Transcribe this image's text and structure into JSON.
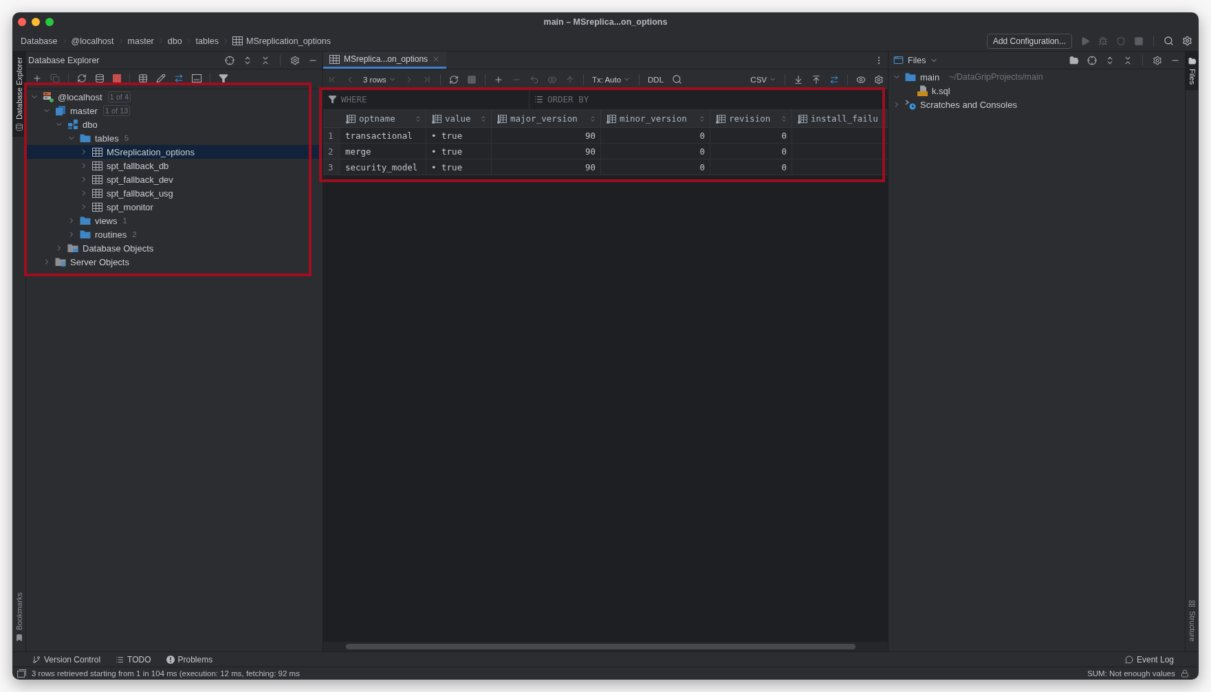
{
  "window": {
    "title": "main – MSreplica...on_options"
  },
  "navigation_bar": {
    "breadcrumbs": [
      {
        "label": "Database",
        "kind": "plain"
      },
      {
        "label": "@localhost",
        "kind": "plain"
      },
      {
        "label": "master",
        "kind": "plain"
      },
      {
        "label": "dbo",
        "kind": "plain"
      },
      {
        "label": "tables",
        "kind": "plain"
      },
      {
        "label": "MSreplication_options",
        "kind": "table"
      }
    ],
    "configuration_button": "Add Configuration..."
  },
  "left_stripe": {
    "top": [
      {
        "label": "Database Explorer",
        "kind": "database",
        "selected": true
      }
    ],
    "bottom": [
      {
        "label": "Bookmarks",
        "kind": "bookmarks",
        "selected": false
      }
    ]
  },
  "database_explorer": {
    "title": "Database Explorer",
    "highlighted": true,
    "tree": [
      {
        "label": "@localhost",
        "kind": "host",
        "badge": "1 of 4",
        "expanded": true,
        "selected": false,
        "children": [
          {
            "label": "master",
            "kind": "database",
            "badge": "1 of 13",
            "expanded": true,
            "selected": false,
            "children": [
              {
                "label": "dbo",
                "kind": "schema",
                "expanded": true,
                "selected": false,
                "children": [
                  {
                    "label": "tables",
                    "kind": "folder",
                    "count": "5",
                    "expanded": true,
                    "selected": false,
                    "children": [
                      {
                        "label": "MSreplication_options",
                        "kind": "table",
                        "expanded": false,
                        "selected": true
                      },
                      {
                        "label": "spt_fallback_db",
                        "kind": "table",
                        "expanded": false,
                        "selected": false
                      },
                      {
                        "label": "spt_fallback_dev",
                        "kind": "table",
                        "expanded": false,
                        "selected": false
                      },
                      {
                        "label": "spt_fallback_usg",
                        "kind": "table",
                        "expanded": false,
                        "selected": false
                      },
                      {
                        "label": "spt_monitor",
                        "kind": "table",
                        "expanded": false,
                        "selected": false
                      }
                    ]
                  },
                  {
                    "label": "views",
                    "kind": "folder",
                    "count": "1",
                    "expanded": false,
                    "selected": false
                  },
                  {
                    "label": "routines",
                    "kind": "folder",
                    "count": "2",
                    "expanded": false,
                    "selected": false
                  }
                ]
              },
              {
                "label": "Database Objects",
                "kind": "objects",
                "expanded": false,
                "selected": false
              }
            ]
          },
          {
            "label": "Server Objects",
            "kind": "server_objects",
            "expanded": false,
            "selected": false
          }
        ]
      }
    ]
  },
  "editor": {
    "tabs": [
      {
        "label": "MSreplica...on_options",
        "selected": true
      }
    ],
    "toolbar": {
      "rows": "3 rows",
      "transaction": "Tx: Auto",
      "ddl": "DDL",
      "export_format": "CSV"
    },
    "filter": {
      "where_placeholder": "WHERE",
      "order_placeholder": "ORDER BY"
    },
    "grid": {
      "highlighted": true,
      "columns": [
        {
          "name": "optname",
          "kind": "text"
        },
        {
          "name": "value",
          "kind": "text"
        },
        {
          "name": "major_version",
          "kind": "number"
        },
        {
          "name": "minor_version",
          "kind": "number"
        },
        {
          "name": "revision",
          "kind": "number"
        },
        {
          "name": "install_failu",
          "truncated": true
        }
      ],
      "rows": [
        {
          "number": "1",
          "cells": [
            "transactional",
            "• true",
            "90",
            "0",
            "0"
          ]
        },
        {
          "number": "2",
          "cells": [
            "merge",
            "• true",
            "90",
            "0",
            "0"
          ]
        },
        {
          "number": "3",
          "cells": [
            "security_model",
            "• true",
            "90",
            "0",
            "0"
          ]
        }
      ]
    }
  },
  "files_panel": {
    "title": "Files",
    "tree": [
      {
        "label": "main",
        "kind": "folder",
        "path": "~/DataGripProjects/main",
        "expanded": true,
        "selected": false,
        "children": [
          {
            "label": "k.sql",
            "kind": "sql",
            "selected": false
          }
        ]
      },
      {
        "label": "Scratches and Consoles",
        "kind": "scratches",
        "expanded": false,
        "selected": false
      }
    ]
  },
  "right_stripe": {
    "top": [
      {
        "label": "Files",
        "kind": "files",
        "selected": true
      }
    ],
    "bottom": [
      {
        "label": "Structure",
        "kind": "structure",
        "selected": false
      }
    ]
  },
  "tool_window_bar": {
    "left": [
      {
        "label": "Version Control",
        "kind": "vcs"
      },
      {
        "label": "TODO",
        "kind": "todo"
      },
      {
        "label": "Problems",
        "kind": "problems"
      }
    ],
    "right": [
      {
        "label": "Event Log",
        "kind": "events"
      }
    ]
  },
  "status_bar": {
    "message": "3 rows retrieved starting from 1 in 104 ms (execution: 12 ms, fetching: 92 ms",
    "summary": "SUM: Not enough values"
  }
}
